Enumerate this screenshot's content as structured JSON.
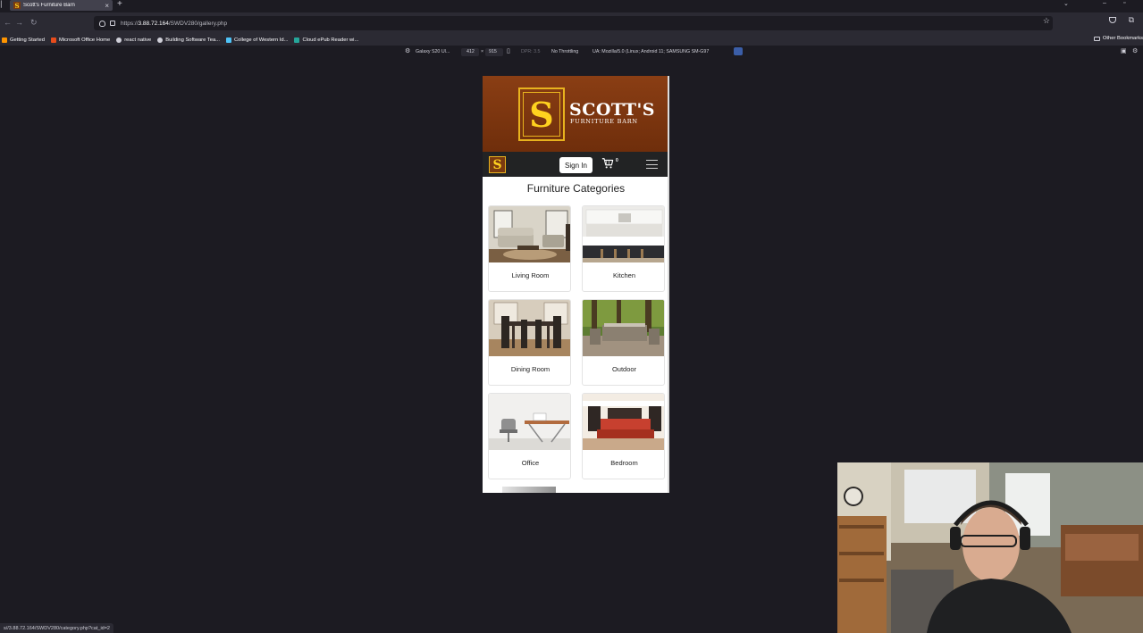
{
  "browser": {
    "tab_title": "Scott's Furniture Barn",
    "tab_close": "×",
    "new_tab": "+",
    "url_prefix": "https://",
    "url_host": "3.88.72.164",
    "url_path": "/SWDV280/gallery.php",
    "bookmarks": [
      {
        "label": "Getting Started",
        "color": "#ff9500"
      },
      {
        "label": "Microsoft Office Home",
        "color": "#e74c1c"
      },
      {
        "label": "react native",
        "color": "#cfcfd8"
      },
      {
        "label": "Building Software Tea...",
        "color": "#cfcfd8"
      },
      {
        "label": "College of Western Id...",
        "color": "#4fc3f7"
      },
      {
        "label": "Cloud ePub Reader wi...",
        "color": "#26a69a"
      }
    ],
    "other_bookmarks": "Other Bookmarks",
    "status_link": "s//3.88.72.164/SWDV280/category.php?cat_id=2"
  },
  "rdm": {
    "device": "Galaxy S20 Ul...",
    "width": "412",
    "times": "×",
    "height": "915",
    "dpr": "DPR: 3.5",
    "throttling": "No Throttling",
    "ua": "UA: Mozilla/5.0 (Linux; Android 11; SAMSUNG SM-G97"
  },
  "site": {
    "logo_letter": "S",
    "logo_name": "SCOTT'S",
    "logo_sub": "FURNITURE BARN",
    "signin": "Sign In",
    "cart_count": "0",
    "heading": "Furniture Categories",
    "categories": [
      {
        "label": "Living Room"
      },
      {
        "label": "Kitchen"
      },
      {
        "label": "Dining Room"
      },
      {
        "label": "Outdoor"
      },
      {
        "label": "Office"
      },
      {
        "label": "Bedroom"
      }
    ]
  },
  "colors": {
    "banner": "#7a3410",
    "gold": "#ffd21f",
    "nav": "#222324"
  }
}
